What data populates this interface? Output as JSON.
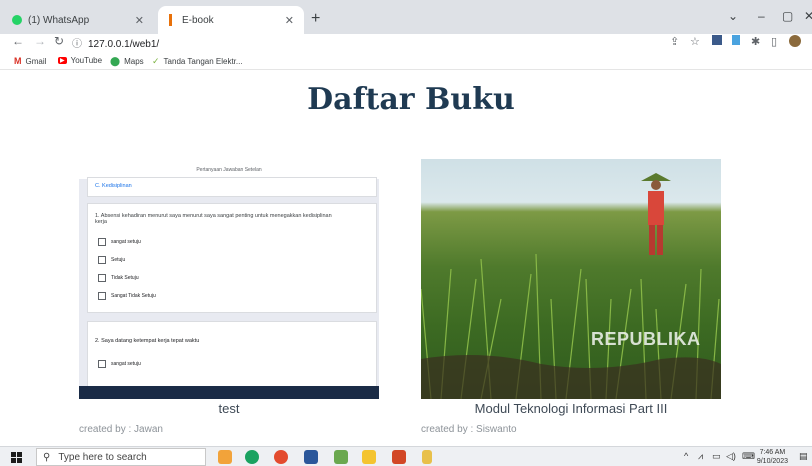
{
  "browser": {
    "tabs": [
      {
        "title": "(1) WhatsApp",
        "favicon": "whatsapp-icon",
        "active": false
      },
      {
        "title": "E-book",
        "favicon": "ebook-icon",
        "active": true
      }
    ],
    "url": "127.0.0.1/web1/",
    "bookmarks": [
      {
        "label": "Gmail",
        "icon": "gmail-icon"
      },
      {
        "label": "YouTube",
        "icon": "youtube-icon"
      },
      {
        "label": "Maps",
        "icon": "maps-icon"
      },
      {
        "label": "Tanda Tangan Elektr...",
        "icon": "signature-icon"
      }
    ]
  },
  "page": {
    "title": "Daftar Buku",
    "books": [
      {
        "title": "test",
        "author": "created by : Jawan",
        "cover": {
          "tabs": "Pertanyaan   Jawaban   Setelan",
          "prev_option": "C. Kedisiplinan",
          "q1": "1. Absensi kehadiran menurut saya menurut saya sangat penting untuk menegakkan kedisiplinan kerja",
          "q1_options": [
            "sangat setuju",
            "Setuju",
            "Tidak Setuju",
            "Sangat Tidak Setuju"
          ],
          "q2": "2.   Saya datang ketempat kerja tepat waktu",
          "q2_options": [
            "sangat setuju"
          ]
        }
      },
      {
        "title": "Modul Teknologi Informasi Part III",
        "author": "created by : Siswanto",
        "cover": {
          "watermark": "REPUBLIKA"
        }
      }
    ]
  },
  "taskbar": {
    "search_placeholder": "Type here to search",
    "time": "7:46 AM",
    "date": "9/10/2023"
  }
}
